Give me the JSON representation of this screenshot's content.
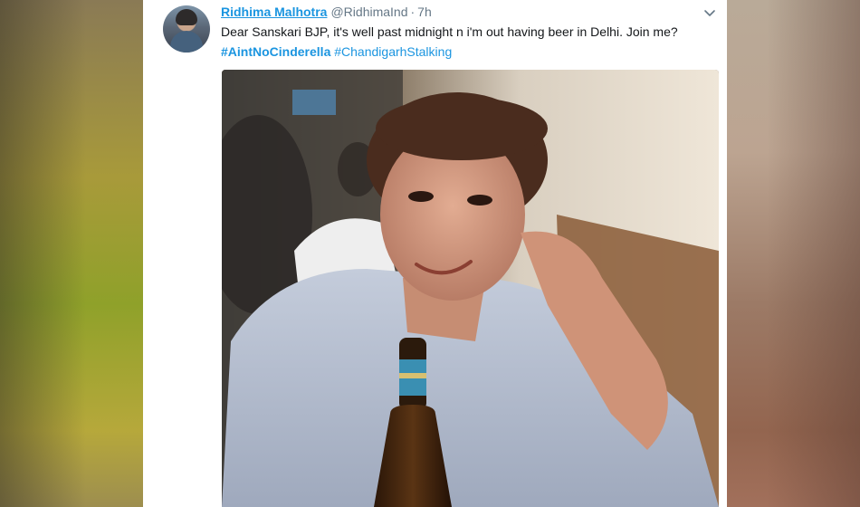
{
  "tweet": {
    "author_name": "Ridhima Malhotra",
    "author_handle": "@RidhimaInd",
    "separator": "·",
    "timestamp": "7h",
    "text": "Dear Sanskari BJP, it's well past midnight n i'm out having beer in Delhi. Join me?",
    "hashtags": [
      "#AintNoCinderella",
      "#ChandigarhStalking"
    ]
  },
  "icons": {
    "menu": "chevron-down-icon",
    "avatar": "profile-avatar"
  },
  "colors": {
    "link": "#1b95e0",
    "text": "#14171a",
    "muted": "#657786"
  }
}
